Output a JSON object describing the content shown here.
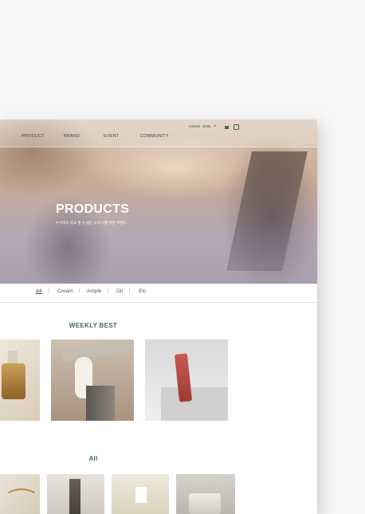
{
  "nav": {
    "links": [
      "PRODUCT",
      "BRAND",
      "EVENT",
      "COMMUNITY"
    ],
    "login": "LOGIN",
    "join": "JOIN",
    "icons": [
      "search-icon",
      "card-icon",
      "cart-icon"
    ]
  },
  "hero": {
    "title": "PRODUCTS",
    "subtitle": "누구라도 비교 할 수 없는 오직 나를 위한 브랜드"
  },
  "tabs": {
    "items": [
      "All",
      "Cream",
      "Ample",
      "Oil",
      "Etc"
    ],
    "active": "All"
  },
  "sections": {
    "weekly_best": "WEEKLY BEST",
    "all": "All"
  },
  "colors": {
    "accent_green": "#3f6b4c"
  }
}
